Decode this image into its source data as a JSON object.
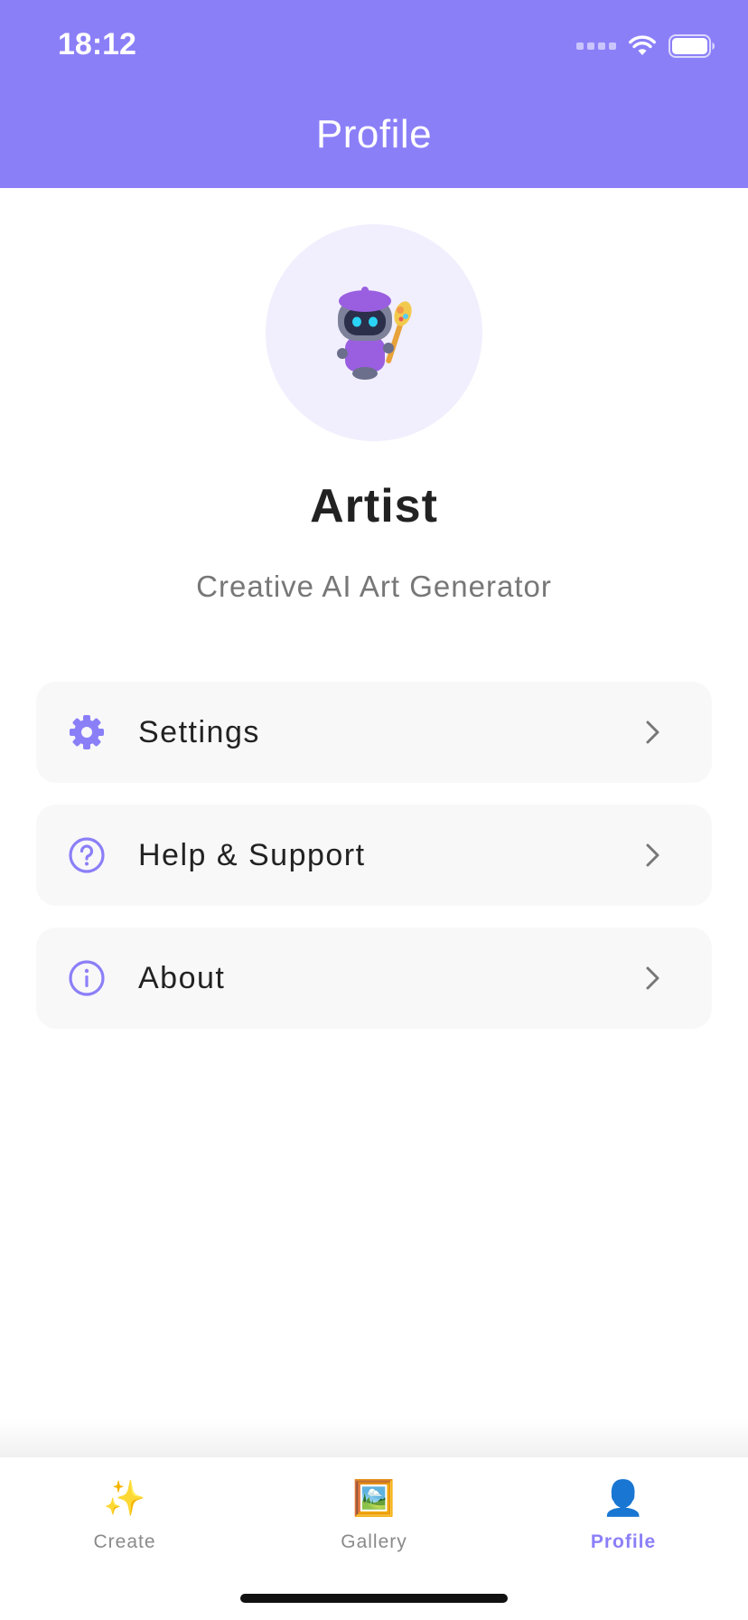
{
  "status_bar": {
    "time": "18:12"
  },
  "header": {
    "title": "Profile"
  },
  "profile": {
    "avatar_icon": "robot-artist-icon",
    "name": "Artist",
    "subtitle": "Creative AI Art Generator"
  },
  "menu": [
    {
      "label": "Settings",
      "icon": "gear-icon"
    },
    {
      "label": "Help & Support",
      "icon": "question-circle-icon"
    },
    {
      "label": "About",
      "icon": "info-circle-icon"
    }
  ],
  "tabs": [
    {
      "label": "Create",
      "icon": "sparkles-icon",
      "glyph": "✨",
      "active": false
    },
    {
      "label": "Gallery",
      "icon": "framed-picture-icon",
      "glyph": "🖼️",
      "active": false
    },
    {
      "label": "Profile",
      "icon": "person-silhouette-icon",
      "glyph": "👤",
      "active": true
    }
  ],
  "colors": {
    "accent": "#8b7ff8",
    "avatar_bg": "#f1effd",
    "card_bg": "#f8f8f9"
  }
}
